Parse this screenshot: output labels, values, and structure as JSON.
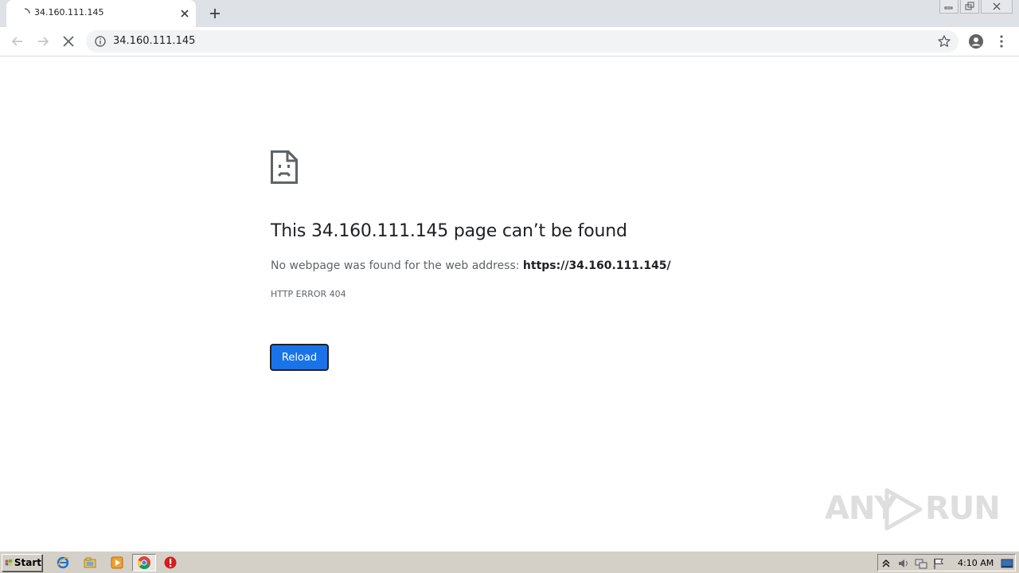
{
  "browser": {
    "tab": {
      "title": "34.160.111.145"
    },
    "address_bar": {
      "url": "34.160.111.145"
    }
  },
  "page": {
    "title": "This 34.160.111.145 page can’t be found",
    "description_prefix": "No webpage was found for the web address: ",
    "description_url": "https://34.160.111.145/",
    "error_code": "HTTP ERROR 404",
    "reload_label": "Reload"
  },
  "watermark": {
    "text_left": "ANY",
    "text_right": "RUN"
  },
  "taskbar": {
    "start_label": "Start",
    "clock": "4:10 AM"
  },
  "colors": {
    "accent": "#1a73e8",
    "text_primary": "#202124",
    "text_secondary": "#5f6368",
    "tab_strip": "#dee1e6",
    "omnibox": "#f1f3f4",
    "taskbar": "#d4d0c8"
  }
}
